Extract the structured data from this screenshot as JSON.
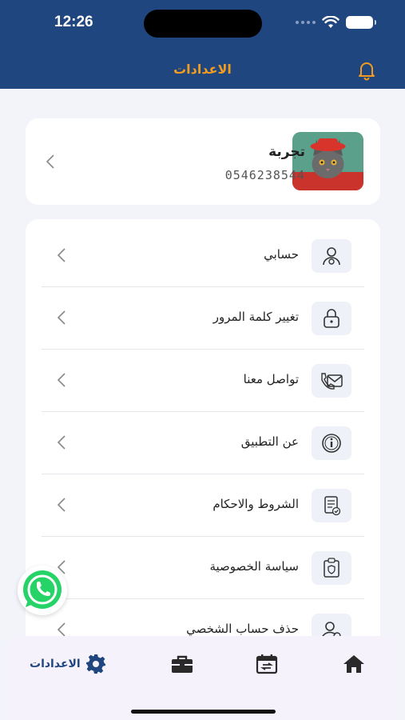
{
  "status_bar": {
    "time": "12:26"
  },
  "header": {
    "title": "الاعدادات"
  },
  "profile": {
    "name": "تجربة",
    "phone": "0546238544"
  },
  "menu": {
    "items": [
      {
        "label": "حسابي",
        "icon": "user-gear-icon"
      },
      {
        "label": "تغيير كلمة المرور",
        "icon": "lock-icon"
      },
      {
        "label": "تواصل معنا",
        "icon": "phone-mail-icon"
      },
      {
        "label": "عن التطبيق",
        "icon": "info-icon"
      },
      {
        "label": "الشروط والاحكام",
        "icon": "document-check-icon"
      },
      {
        "label": "سياسة الخصوصية",
        "icon": "privacy-clipboard-icon"
      },
      {
        "label": "حذف حساب الشخصي",
        "icon": "user-delete-icon"
      }
    ]
  },
  "bottom_nav": {
    "settings_label": "الاعدادات",
    "items": [
      "settings-icon",
      "briefcase-icon",
      "calendar-swap-icon",
      "home-icon"
    ]
  },
  "colors": {
    "header": "#204680",
    "accent": "#f29c1f",
    "whatsapp": "#25d366"
  }
}
